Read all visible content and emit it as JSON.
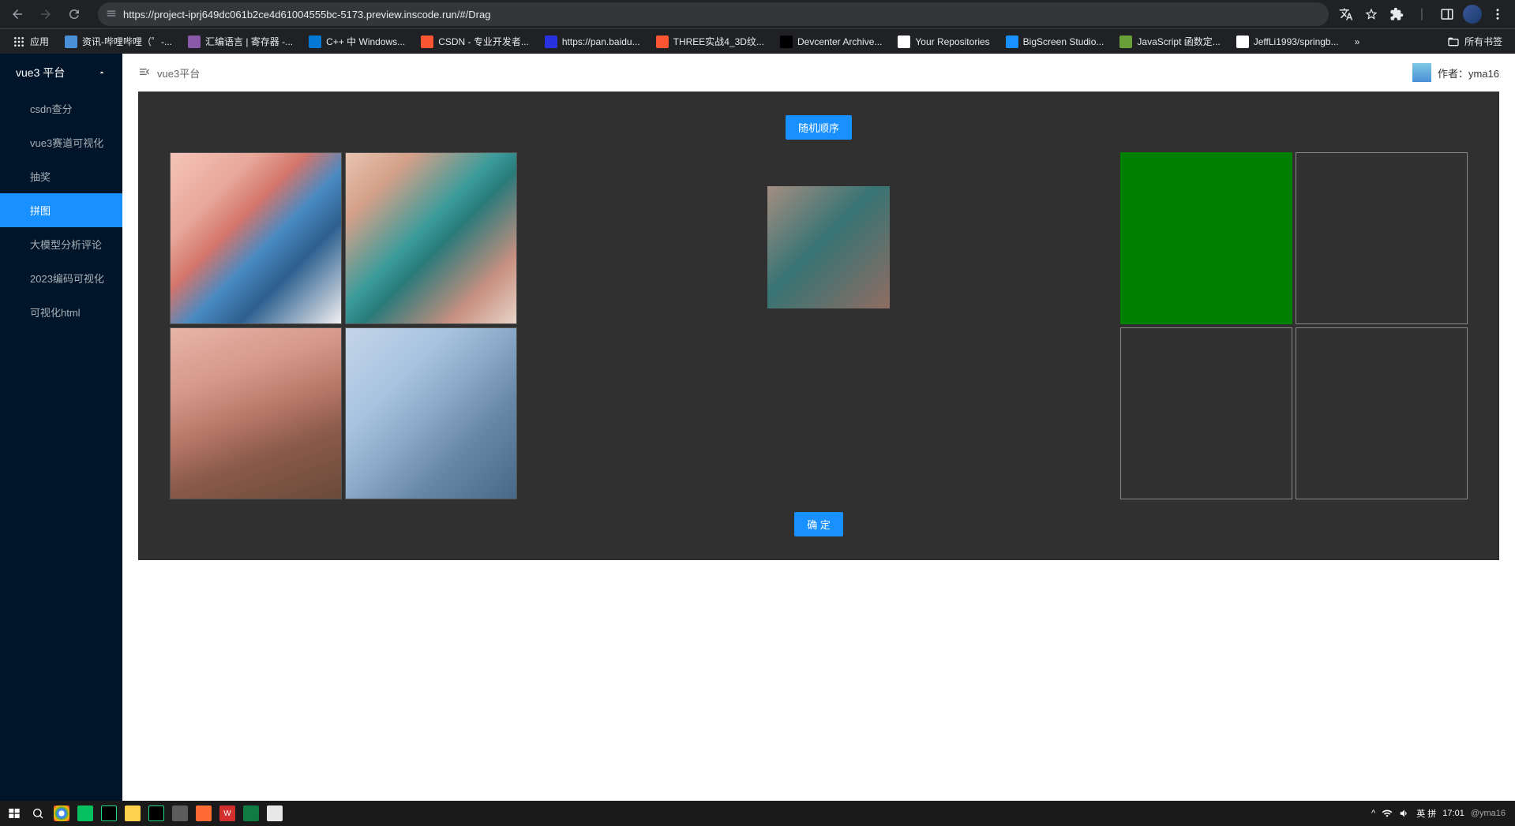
{
  "browser": {
    "url": "https://project-iprj649dc061b2ce4d61004555bc-5173.preview.inscode.run/#/Drag",
    "bookmarks_label": "应用",
    "bookmarks": [
      {
        "label": "资讯-哔哩哔哩（゜-...",
        "color": "#4a90d9"
      },
      {
        "label": "汇编语言 | 寄存器 -...",
        "color": "#8a5aa8"
      },
      {
        "label": "C++ 中 Windows...",
        "color": "#0078d4"
      },
      {
        "label": "CSDN - 专业开发者...",
        "color": "#fc5531"
      },
      {
        "label": "https://pan.baidu...",
        "color": "#2932e1"
      },
      {
        "label": "THREE实战4_3D纹...",
        "color": "#fc5531"
      },
      {
        "label": "Devcenter Archive...",
        "color": "#000"
      },
      {
        "label": "Your Repositories",
        "color": "#fff"
      },
      {
        "label": "BigScreen Studio...",
        "color": "#1890ff"
      },
      {
        "label": "JavaScript 函数定...",
        "color": "#689f38"
      },
      {
        "label": "JeffLi1993/springb...",
        "color": "#fff"
      }
    ],
    "more_label": "»",
    "all_bookmarks_label": "所有书签"
  },
  "sidebar": {
    "title": "vue3 平台",
    "items": [
      {
        "label": "csdn查分"
      },
      {
        "label": "vue3赛道可视化"
      },
      {
        "label": "抽奖"
      },
      {
        "label": "拼图"
      },
      {
        "label": "大模型分析评论"
      },
      {
        "label": "2023编码可视化"
      },
      {
        "label": "可视化html"
      }
    ],
    "active_index": 3
  },
  "topbar": {
    "breadcrumb": "vue3平台",
    "author_label": "作者：yma16"
  },
  "game": {
    "shuffle_btn": "随机顺序",
    "confirm_btn": "确 定",
    "tiles": [
      "tile-1",
      "tile-2",
      "tile-3",
      "tile-4"
    ],
    "dragging_tile_index": 1,
    "target_hover_index": 0
  },
  "taskbar": {
    "ime": "英  拼",
    "time": "17:01",
    "date_tip": "@yma16"
  }
}
